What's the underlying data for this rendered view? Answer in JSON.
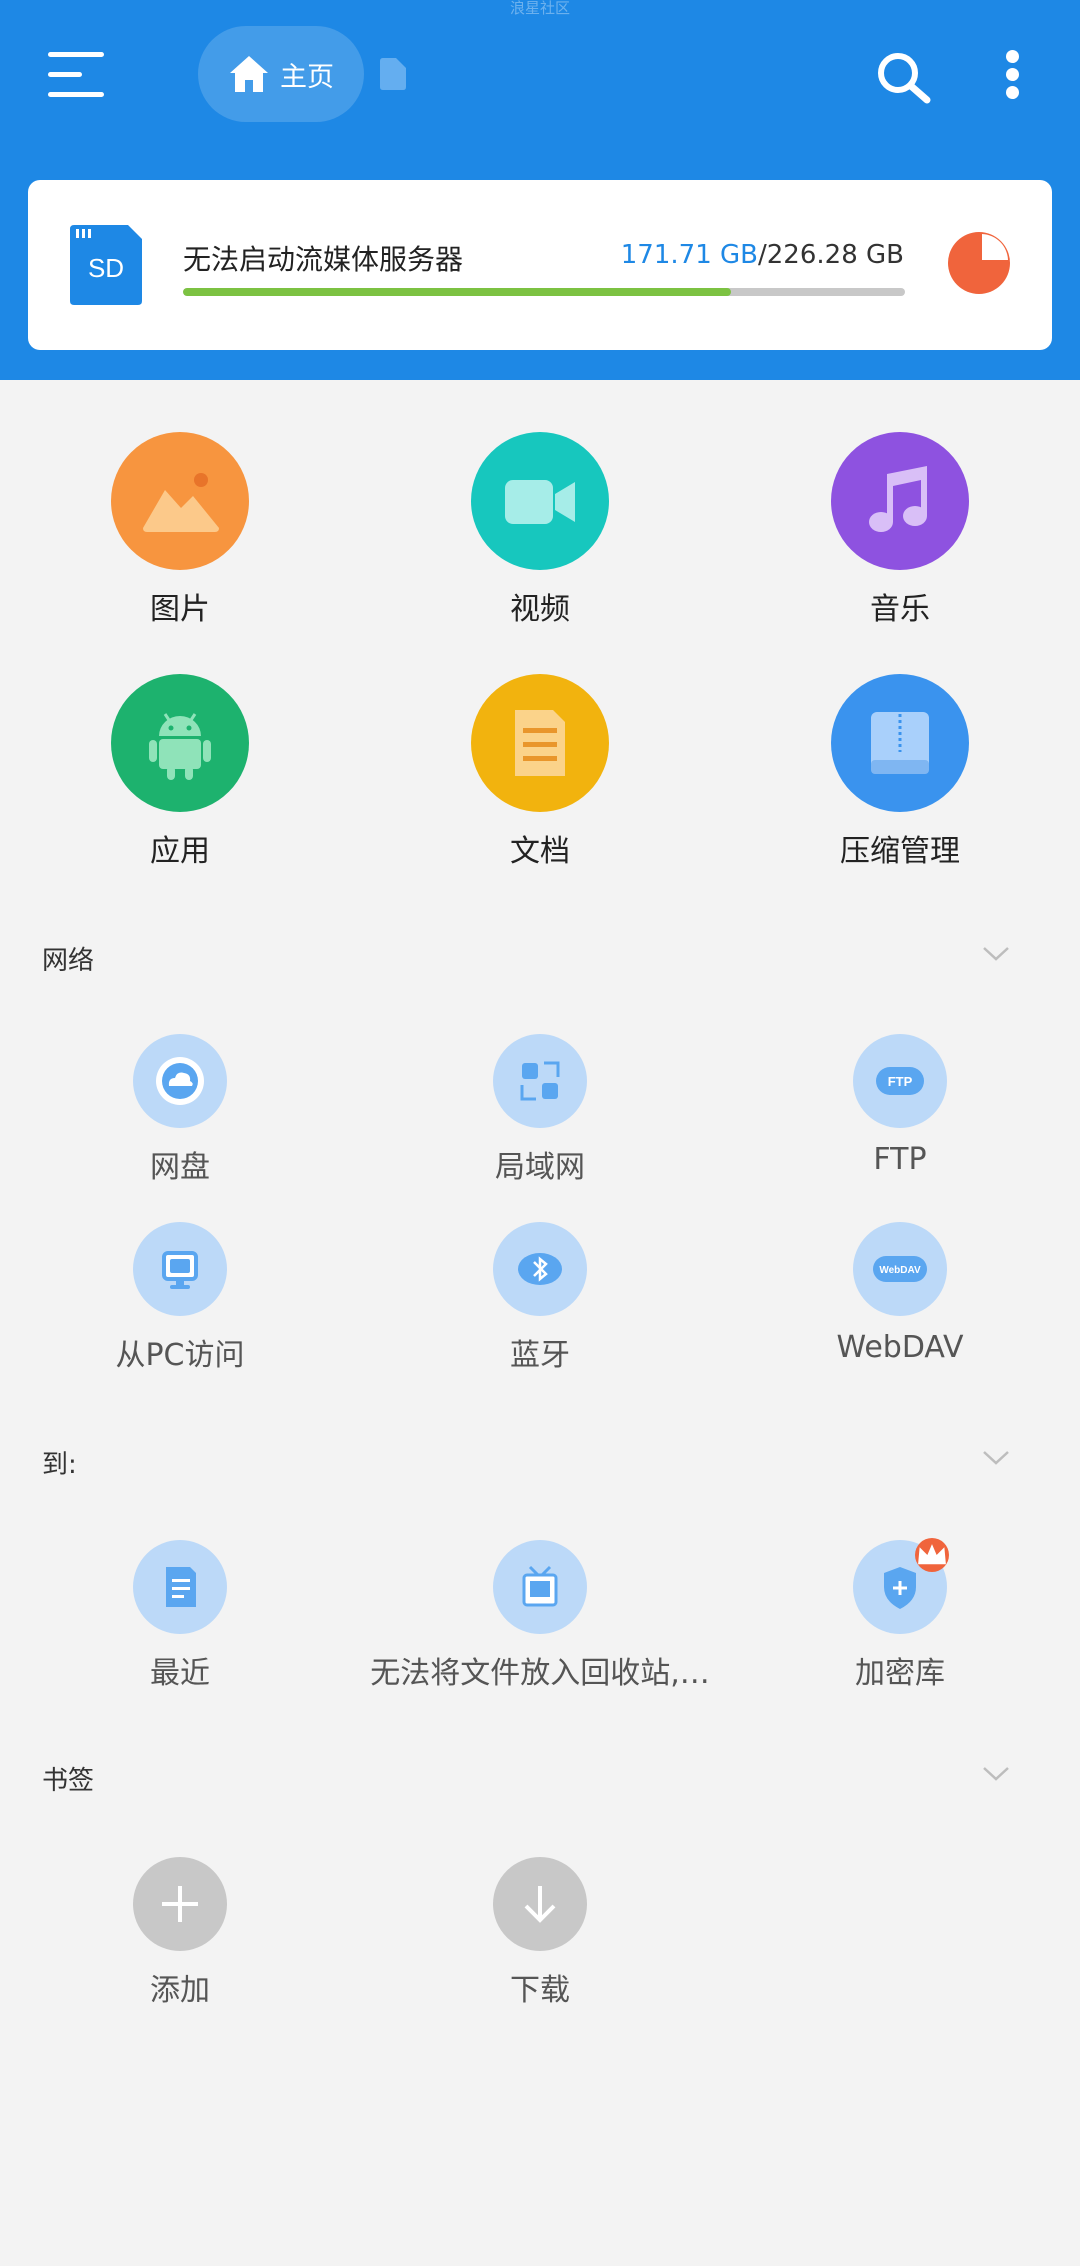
{
  "watermark": "浪星社区",
  "header": {
    "home_tab_label": "主页"
  },
  "storage": {
    "card_icon_text": "SD",
    "name": "无法启动流媒体服务器",
    "used": "171.71 GB",
    "separator": "/",
    "total": "226.28 GB",
    "used_fraction": 0.759,
    "bar_color": "#7cc242",
    "pie_color": "#f0643c"
  },
  "categories": [
    {
      "label": "图片",
      "icon": "image-icon",
      "color": "#f7953f"
    },
    {
      "label": "视频",
      "icon": "video-icon",
      "color": "#17c7be"
    },
    {
      "label": "音乐",
      "icon": "music-icon",
      "color": "#8e52e0"
    },
    {
      "label": "应用",
      "icon": "android-icon",
      "color": "#1db26e"
    },
    {
      "label": "文档",
      "icon": "document-icon",
      "color": "#f2b30e"
    },
    {
      "label": "压缩管理",
      "icon": "archive-icon",
      "color": "#3a93ee"
    }
  ],
  "sections": {
    "network": {
      "title": "网络",
      "items": [
        {
          "label": "网盘",
          "icon": "cloud-drive-icon"
        },
        {
          "label": "局域网",
          "icon": "lan-icon"
        },
        {
          "label": "FTP",
          "icon": "ftp-icon",
          "icon_text": "FTP"
        },
        {
          "label": "从PC访问",
          "icon": "pc-access-icon"
        },
        {
          "label": "蓝牙",
          "icon": "bluetooth-icon"
        },
        {
          "label": "WebDAV",
          "icon": "webdav-icon",
          "icon_text": "WebDAV"
        }
      ]
    },
    "goto": {
      "title": "到:",
      "items": [
        {
          "label": "最近",
          "icon": "recent-icon"
        },
        {
          "label": "无法将文件放入回收站,…",
          "icon": "recycle-bin-icon"
        },
        {
          "label": "加密库",
          "icon": "encrypted-vault-icon"
        }
      ]
    },
    "bookmarks": {
      "title": "书签",
      "items": [
        {
          "label": "添加",
          "icon": "add-icon"
        },
        {
          "label": "下载",
          "icon": "download-icon"
        }
      ]
    }
  }
}
